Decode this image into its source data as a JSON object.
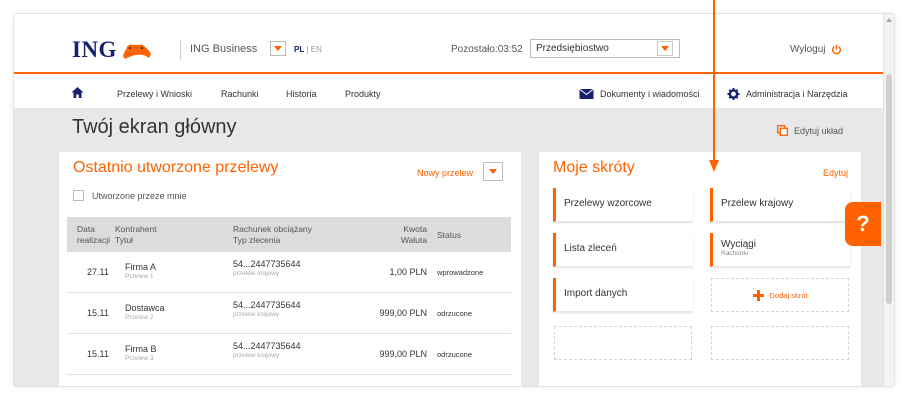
{
  "colors": {
    "accent": "#ff6200",
    "brand_blue": "#16226e"
  },
  "header": {
    "logo": "ING",
    "business": "ING Business",
    "lang_active": "PL",
    "lang_sep": " | ",
    "lang_other": "EN",
    "timer": "Pozostało:03:52",
    "company": "Przedsiębiostwo",
    "logout": "Wyloguj"
  },
  "nav": {
    "items": [
      "Przelewy i Wnioski",
      "Rachunki",
      "Historia",
      "Produkty"
    ],
    "documents": "Dokumenty i wiadomości",
    "admin": "Administracja i Narzędzia"
  },
  "page": {
    "title": "Twój ekran główny",
    "edit_layout": "Edytuj układ"
  },
  "recent": {
    "title": "Ostatnio utworzone przelewy",
    "new_transfer": "Nowy przelew",
    "checkbox_label": "Utworzone przeze mnie",
    "columns": {
      "date1": "Data",
      "date2": "realizacji",
      "contractor": "Kontrahent",
      "title": "Tytuł",
      "account": "Rachunek obciążany",
      "type": "Typ zlecenia",
      "amount": "Kwota",
      "currency": "Waluta",
      "status": "Status"
    },
    "rows": [
      {
        "date": "27.11",
        "name": "Firma A",
        "title": "Przelew 1",
        "account": "54...2447735644",
        "type": "przelew krajowy",
        "amount": "1,00 PLN",
        "status": "wprowadzone"
      },
      {
        "date": "15.11",
        "name": "Dostawca",
        "title": "Przelew 2",
        "account": "54...2447735644",
        "type": "przelew krajowy",
        "amount": "999,00 PLN",
        "status": "odrzucone"
      },
      {
        "date": "15.11",
        "name": "Firma B",
        "title": "Przelew 3",
        "account": "54...2447735644",
        "type": "przelew krajowy",
        "amount": "999,00 PLN",
        "status": "odrzucone"
      }
    ]
  },
  "shortcuts": {
    "title": "Moje skróty",
    "edit": "Edytuj",
    "items": [
      {
        "label": "Przelewy wzorcowe"
      },
      {
        "label": "Przelew krajowy"
      },
      {
        "label": "Lista zleceń"
      },
      {
        "label": "Wyciągi",
        "sub": "Rachunki"
      },
      {
        "label": "Import danych"
      }
    ],
    "add": "Dodaj skrót"
  },
  "help": "?"
}
